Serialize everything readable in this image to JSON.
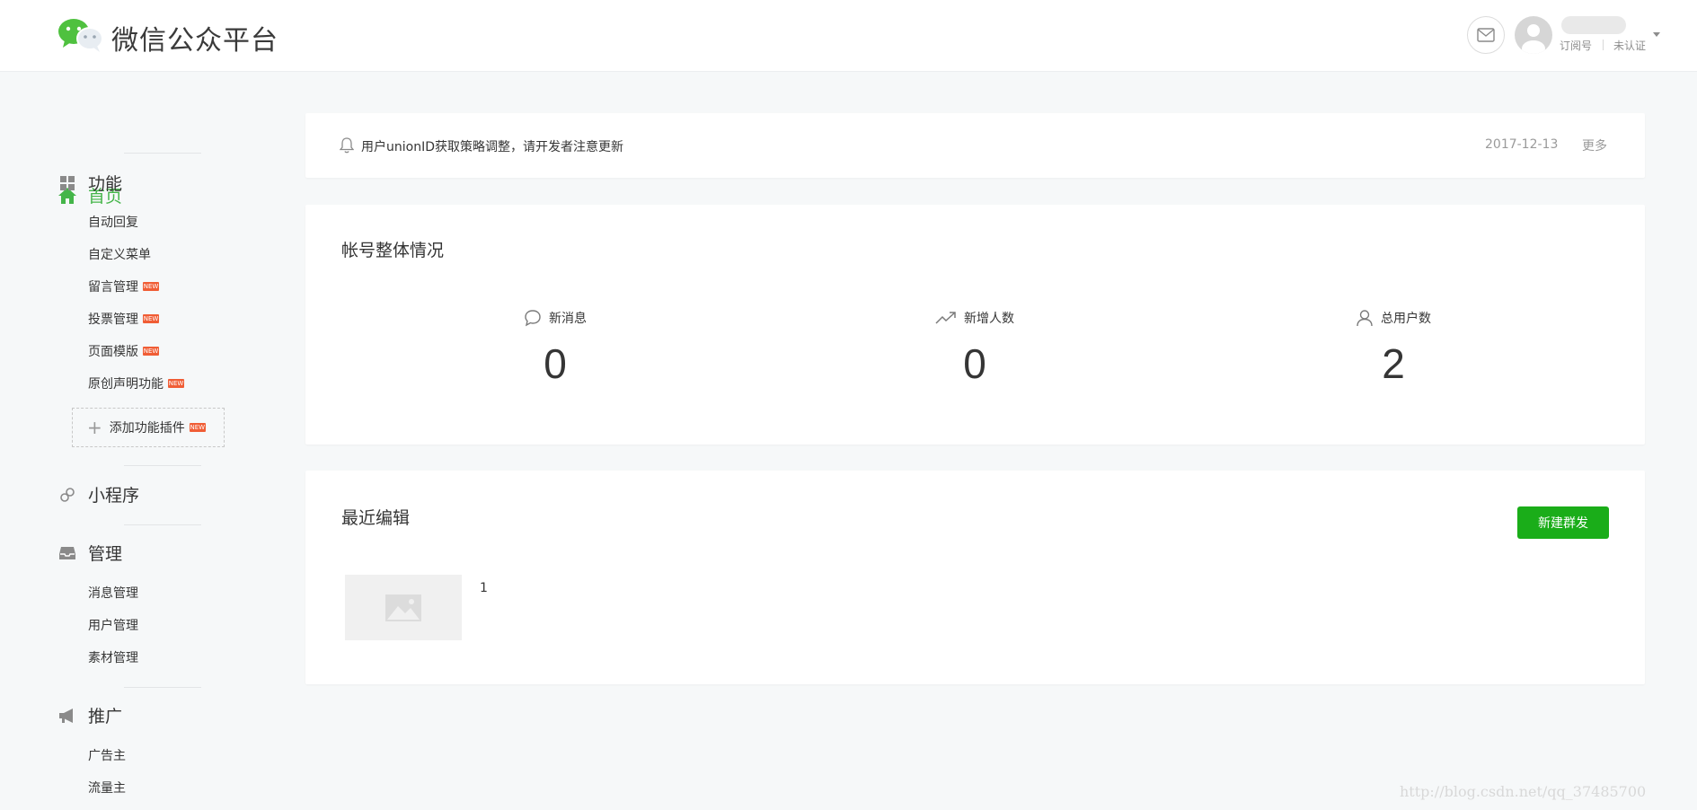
{
  "header": {
    "brand": "微信公众平台",
    "account_type": "订阅号",
    "account_status": "未认证"
  },
  "sidebar": {
    "home": "首页",
    "function": {
      "label": "功能",
      "items": [
        {
          "label": "自动回复",
          "new": false
        },
        {
          "label": "自定义菜单",
          "new": false
        },
        {
          "label": "留言管理",
          "new": true
        },
        {
          "label": "投票管理",
          "new": true
        },
        {
          "label": "页面模版",
          "new": true
        },
        {
          "label": "原创声明功能",
          "new": true
        }
      ],
      "add_plugin": "添加功能插件"
    },
    "miniprogram": "小程序",
    "manage": {
      "label": "管理",
      "items": [
        "消息管理",
        "用户管理",
        "素材管理"
      ]
    },
    "promote": {
      "label": "推广",
      "items": [
        "广告主",
        "流量主"
      ]
    },
    "new_badge": "NEW"
  },
  "notice": {
    "text": "用户unionID获取策略调整，请开发者注意更新",
    "date": "2017-12-13",
    "more": "更多"
  },
  "overview": {
    "title": "帐号整体情况",
    "stats": [
      {
        "label": "新消息",
        "value": "0",
        "icon": "chat-bubble-icon"
      },
      {
        "label": "新增人数",
        "value": "0",
        "icon": "trend-up-icon"
      },
      {
        "label": "总用户数",
        "value": "2",
        "icon": "user-icon"
      }
    ]
  },
  "recent": {
    "title": "最近编辑",
    "new_button": "新建群发",
    "items": [
      {
        "title": "1"
      }
    ]
  },
  "watermark": "http://blog.csdn.net/qq_37485700",
  "colors": {
    "accent": "#44b549",
    "button": "#1aad19",
    "badge": "#f05d35"
  }
}
